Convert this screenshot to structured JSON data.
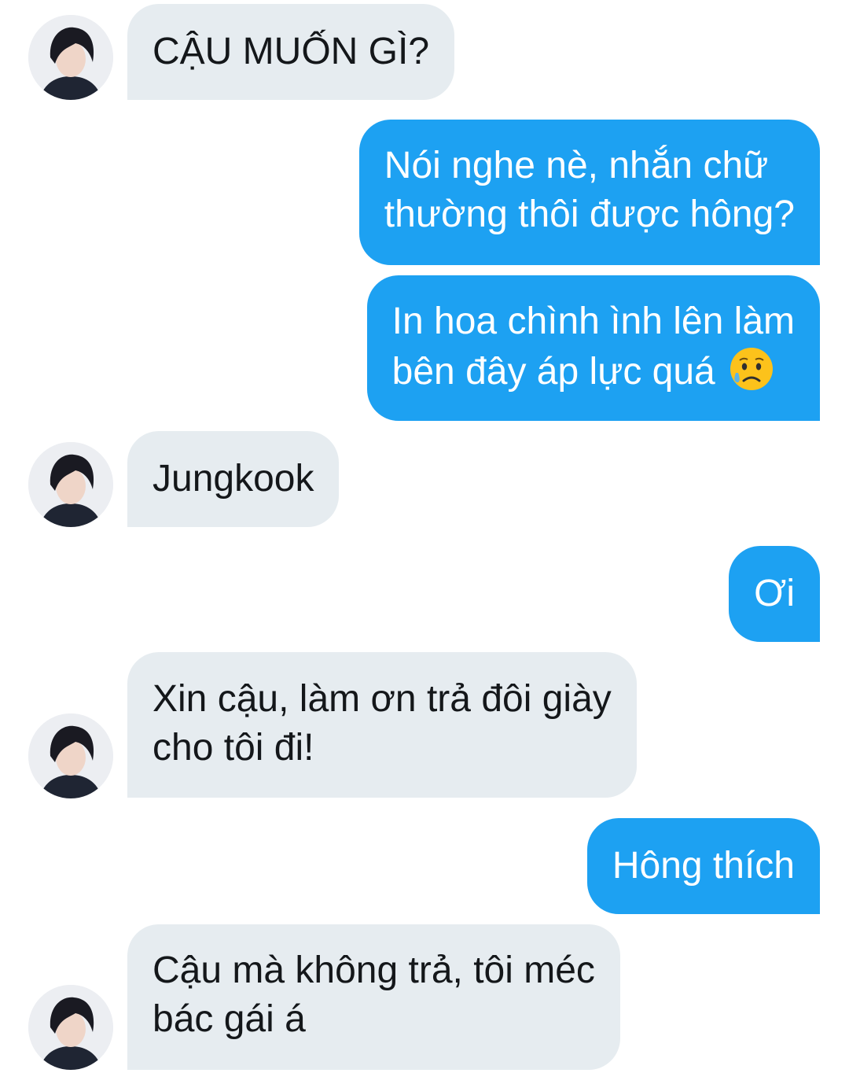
{
  "conversation": {
    "messages": [
      {
        "sender": "them",
        "text": "CẬU MUỐN GÌ?"
      },
      {
        "sender": "me",
        "text": "Nói nghe nè, nhắn chữ\nthường thôi được hông?"
      },
      {
        "sender": "me",
        "text": "In hoa chình ình lên làm\nbên đây áp lực quá",
        "emoji": "sad-but-relieved-face-emoji"
      },
      {
        "sender": "them",
        "text": "Jungkook"
      },
      {
        "sender": "me",
        "text": "Ơi"
      },
      {
        "sender": "them",
        "text": "Xin cậu, làm ơn trả đôi giày\ncho tôi đi!"
      },
      {
        "sender": "me",
        "text": "Hông thích"
      },
      {
        "sender": "them",
        "text": "Cậu mà không trả, tôi méc\nbác gái á"
      }
    ]
  },
  "colors": {
    "incoming_bubble": "#e6ecf0",
    "outgoing_bubble": "#1da1f2",
    "incoming_text": "#14171a",
    "outgoing_text": "#ffffff"
  }
}
